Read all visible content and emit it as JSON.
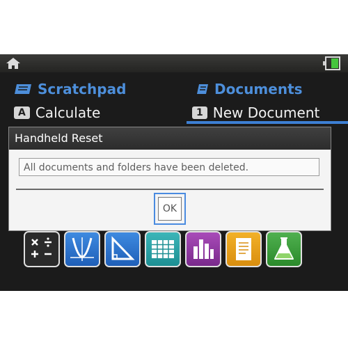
{
  "scratchpad": {
    "header": "Scratchpad",
    "item_key": "A",
    "item_label": "Calculate"
  },
  "documents": {
    "header": "Documents",
    "item_key": "1",
    "item_label": "New Document"
  },
  "dialog": {
    "title": "Handheld Reset",
    "message": "All documents and folders have been deleted.",
    "ok_label": "OK"
  },
  "app_icons": [
    "calculator-icon",
    "graphs-icon",
    "geometry-icon",
    "lists-spreadsheet-icon",
    "data-statistics-icon",
    "notes-icon",
    "vernier-dataquest-icon"
  ],
  "colors": {
    "accent_blue": "#4d8fdb",
    "selection_blue": "#3d7fd4",
    "screen_bg": "#1b1b1b",
    "dialog_bg": "#f4f4f4"
  }
}
